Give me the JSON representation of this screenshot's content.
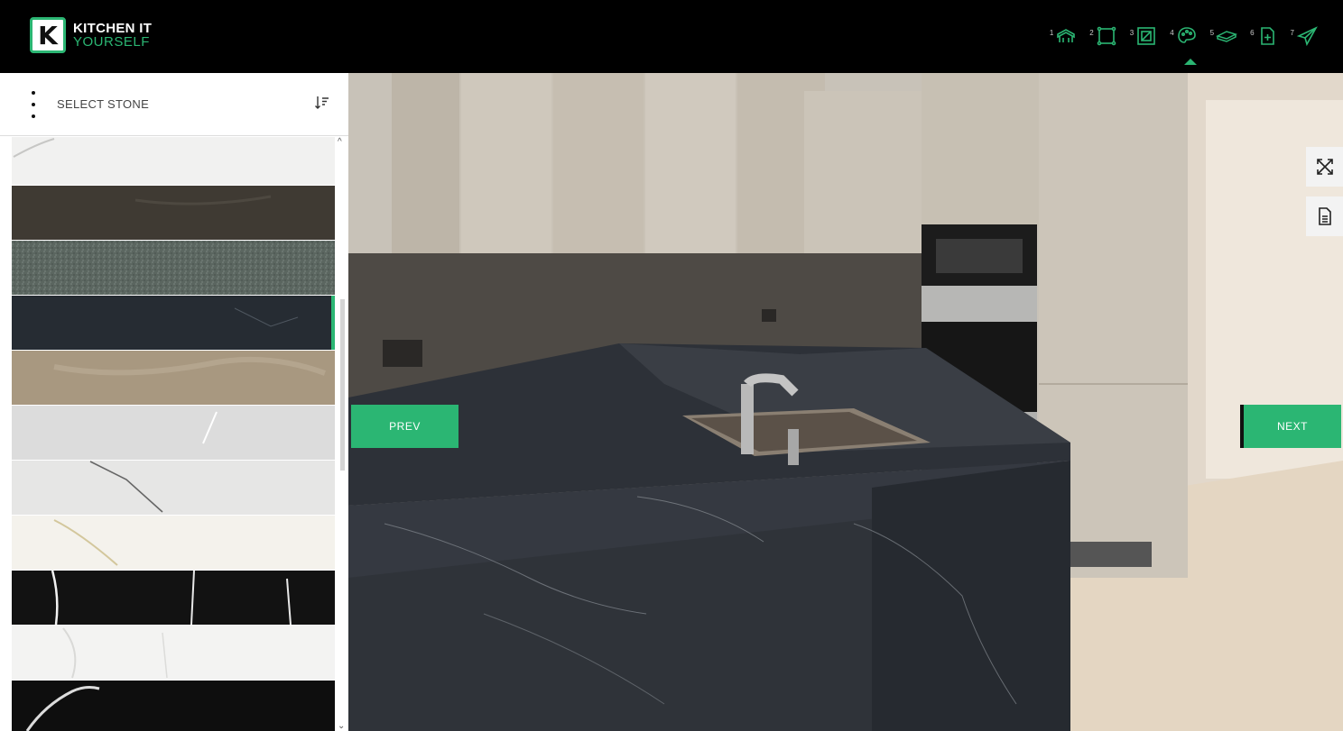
{
  "brand": {
    "line1": "KITCHEN IT",
    "line2": "YOURSELF",
    "accent": "#2bb673"
  },
  "steps": [
    {
      "num": "1",
      "icon": "kitchen-layout-icon"
    },
    {
      "num": "2",
      "icon": "room-dimensions-icon"
    },
    {
      "num": "3",
      "icon": "worktop-shape-icon"
    },
    {
      "num": "4",
      "icon": "palette-icon",
      "active": true
    },
    {
      "num": "5",
      "icon": "worktop-edge-icon"
    },
    {
      "num": "6",
      "icon": "add-document-icon"
    },
    {
      "num": "7",
      "icon": "send-icon"
    }
  ],
  "sidebar": {
    "title": "SELECT STONE",
    "sort_icon": "sort-icon",
    "swatches": [
      {
        "name": "white-marble-top"
      },
      {
        "name": "dark-brown-stone"
      },
      {
        "name": "grey-green-granite"
      },
      {
        "name": "black-veined-quartz",
        "selected": true
      },
      {
        "name": "beige-marble"
      },
      {
        "name": "light-grey-veined"
      },
      {
        "name": "white-grey-veined"
      },
      {
        "name": "white-gold-veined"
      },
      {
        "name": "black-white-veined"
      },
      {
        "name": "white-statuario"
      },
      {
        "name": "black-marquina"
      }
    ]
  },
  "nav": {
    "prev": "PREV",
    "next": "NEXT"
  },
  "tools": {
    "fullscreen_icon": "fullscreen-icon",
    "document_icon": "document-icon"
  }
}
